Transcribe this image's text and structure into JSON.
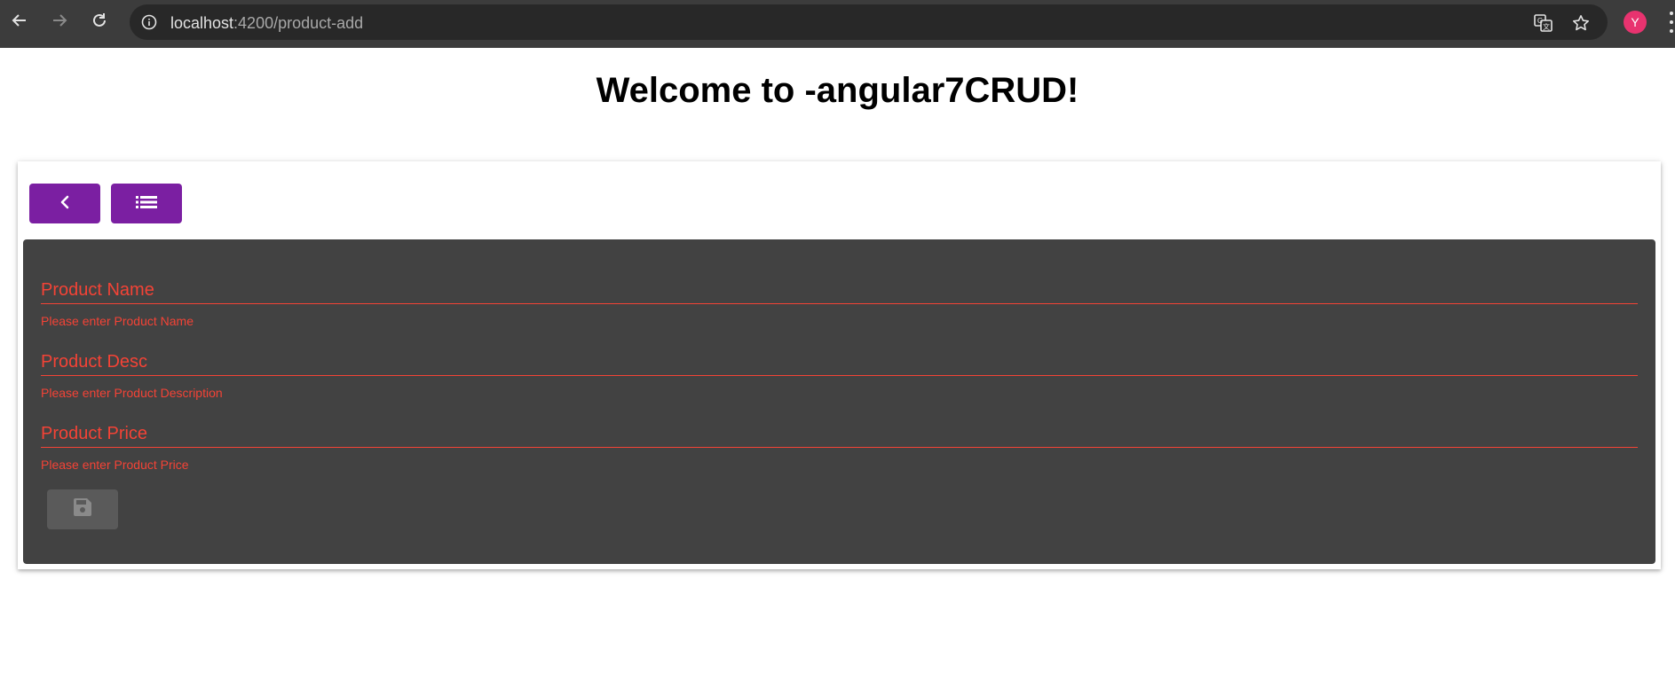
{
  "browser": {
    "url_host": "localhost",
    "url_path": ":4200/product-add",
    "profile_initial": "Y",
    "profile_color": "#e8336f"
  },
  "page": {
    "title": "Welcome to -angular7CRUD!"
  },
  "toolbar": {
    "back_icon": "chevron-left-icon",
    "list_icon": "list-icon",
    "button_color": "#7b1fa2"
  },
  "form": {
    "panel_color": "#424242",
    "error_color": "#f44336",
    "fields": [
      {
        "label": "Product Name",
        "value": "",
        "error": "Please enter Product Name"
      },
      {
        "label": "Product Desc",
        "value": "",
        "error": "Please enter Product Description"
      },
      {
        "label": "Product Price",
        "value": "",
        "error": "Please enter Product Price"
      }
    ],
    "save_icon": "save-icon",
    "save_disabled": true
  }
}
